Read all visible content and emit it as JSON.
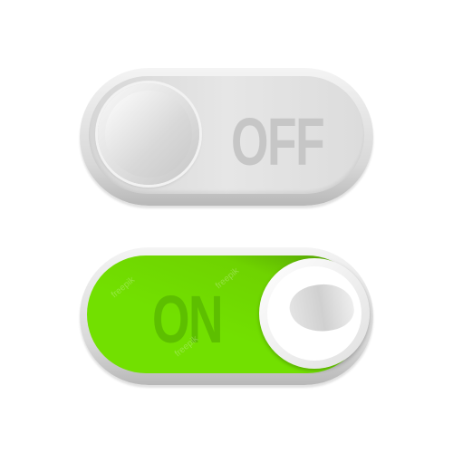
{
  "toggles": [
    {
      "label": "OFF",
      "state": "off",
      "color": "#d9d9d9"
    },
    {
      "label": "ON",
      "state": "on",
      "color": "#72e000"
    }
  ],
  "watermark": "freepik"
}
